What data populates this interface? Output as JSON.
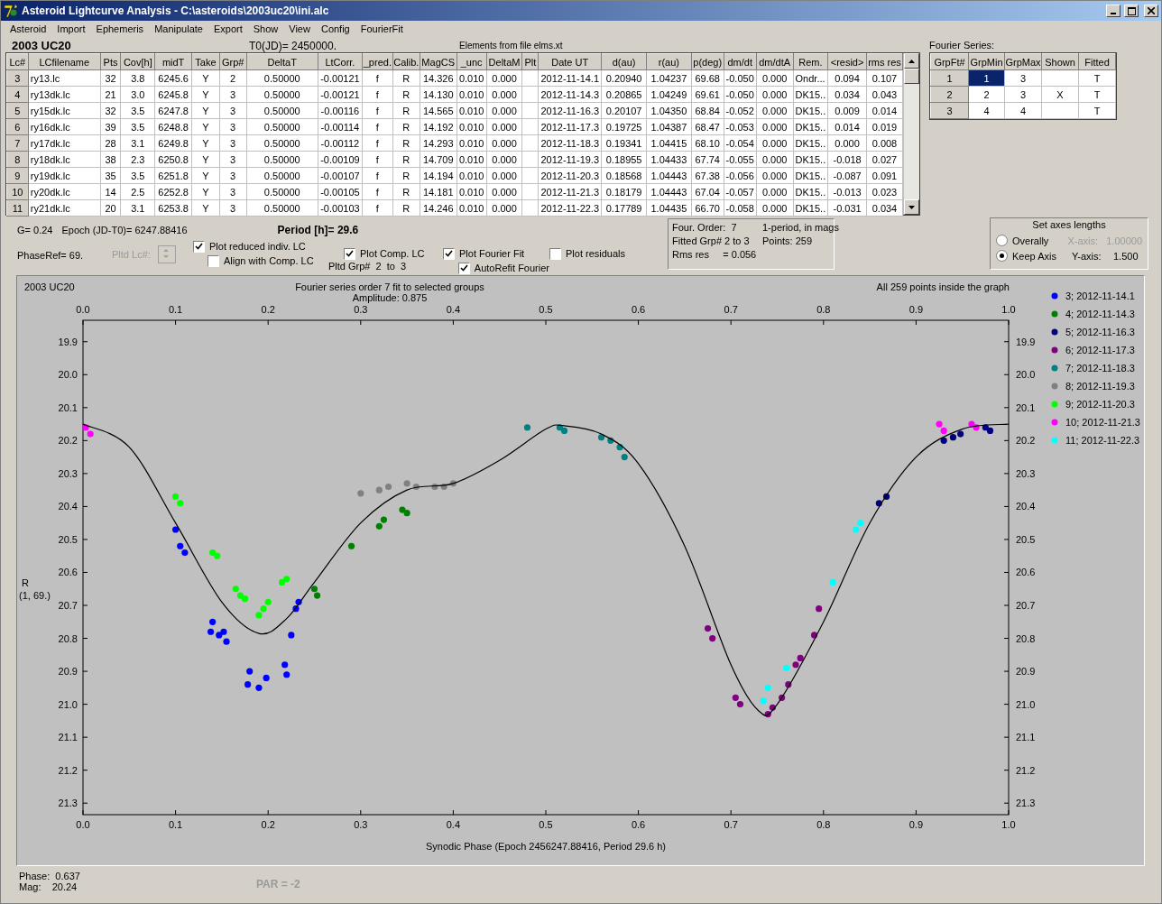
{
  "window": {
    "title": "Asteroid Lightcurve Analysis - C:\\asteroids\\2003uc20\\ini.alc"
  },
  "menu": [
    "Asteroid",
    "Import",
    "Ephemeris",
    "Manipulate",
    "Export",
    "Show",
    "View",
    "Config",
    "FourierFit"
  ],
  "header": {
    "asteroid": "2003 UC20",
    "t0": "T0(JD)= 2450000.",
    "elements": "Elements from file elms.xt"
  },
  "table": {
    "columns": [
      "Lc#",
      "LCfilename",
      "Pts",
      "Cov[h]",
      "midT",
      "Take",
      "Grp#",
      "DeltaT",
      "LtCorr.",
      "_pred.",
      "Calib.",
      "MagCS",
      "_unc",
      "DeltaM",
      "Plt",
      "Date UT",
      "d(au)",
      "r(au)",
      "p(deg)",
      "dm/dt",
      "dm/dtA",
      "Rem.",
      "<resid>",
      "rms res"
    ],
    "rows": [
      [
        "3",
        "ry13.lc",
        "32",
        "3.8",
        "6245.6",
        "Y",
        "2",
        "0.50000",
        "-0.00121",
        "f",
        "R",
        "14.326",
        "0.010",
        "0.000",
        "",
        "2012-11-14.1",
        "0.20940",
        "1.04237",
        "69.68",
        "-0.050",
        "0.000",
        "Ondr...",
        "0.094",
        "0.107"
      ],
      [
        "4",
        "ry13dk.lc",
        "21",
        "3.0",
        "6245.8",
        "Y",
        "3",
        "0.50000",
        "-0.00121",
        "f",
        "R",
        "14.130",
        "0.010",
        "0.000",
        "",
        "2012-11-14.3",
        "0.20865",
        "1.04249",
        "69.61",
        "-0.050",
        "0.000",
        "DK15..",
        "0.034",
        "0.043"
      ],
      [
        "5",
        "ry15dk.lc",
        "32",
        "3.5",
        "6247.8",
        "Y",
        "3",
        "0.50000",
        "-0.00116",
        "f",
        "R",
        "14.565",
        "0.010",
        "0.000",
        "",
        "2012-11-16.3",
        "0.20107",
        "1.04350",
        "68.84",
        "-0.052",
        "0.000",
        "DK15..",
        "0.009",
        "0.014"
      ],
      [
        "6",
        "ry16dk.lc",
        "39",
        "3.5",
        "6248.8",
        "Y",
        "3",
        "0.50000",
        "-0.00114",
        "f",
        "R",
        "14.192",
        "0.010",
        "0.000",
        "",
        "2012-11-17.3",
        "0.19725",
        "1.04387",
        "68.47",
        "-0.053",
        "0.000",
        "DK15..",
        "0.014",
        "0.019"
      ],
      [
        "7",
        "ry17dk.lc",
        "28",
        "3.1",
        "6249.8",
        "Y",
        "3",
        "0.50000",
        "-0.00112",
        "f",
        "R",
        "14.293",
        "0.010",
        "0.000",
        "",
        "2012-11-18.3",
        "0.19341",
        "1.04415",
        "68.10",
        "-0.054",
        "0.000",
        "DK15..",
        "0.000",
        "0.008"
      ],
      [
        "8",
        "ry18dk.lc",
        "38",
        "2.3",
        "6250.8",
        "Y",
        "3",
        "0.50000",
        "-0.00109",
        "f",
        "R",
        "14.709",
        "0.010",
        "0.000",
        "",
        "2012-11-19.3",
        "0.18955",
        "1.04433",
        "67.74",
        "-0.055",
        "0.000",
        "DK15..",
        "-0.018",
        "0.027"
      ],
      [
        "9",
        "ry19dk.lc",
        "35",
        "3.5",
        "6251.8",
        "Y",
        "3",
        "0.50000",
        "-0.00107",
        "f",
        "R",
        "14.194",
        "0.010",
        "0.000",
        "",
        "2012-11-20.3",
        "0.18568",
        "1.04443",
        "67.38",
        "-0.056",
        "0.000",
        "DK15..",
        "-0.087",
        "0.091"
      ],
      [
        "10",
        "ry20dk.lc",
        "14",
        "2.5",
        "6252.8",
        "Y",
        "3",
        "0.50000",
        "-0.00105",
        "f",
        "R",
        "14.181",
        "0.010",
        "0.000",
        "",
        "2012-11-21.3",
        "0.18179",
        "1.04443",
        "67.04",
        "-0.057",
        "0.000",
        "DK15..",
        "-0.013",
        "0.023"
      ],
      [
        "11",
        "ry21dk.lc",
        "20",
        "3.1",
        "6253.8",
        "Y",
        "3",
        "0.50000",
        "-0.00103",
        "f",
        "R",
        "14.246",
        "0.010",
        "0.000",
        "",
        "2012-11-22.3",
        "0.17789",
        "1.04435",
        "66.70",
        "-0.058",
        "0.000",
        "DK15..",
        "-0.031",
        "0.034"
      ]
    ]
  },
  "fourier_series": {
    "label": "Fourier Series:",
    "columns": [
      "GrpFt#",
      "GrpMin",
      "GrpMax",
      "Shown",
      "Fitted"
    ],
    "rows": [
      {
        "cells": [
          {
            "text": "1",
            "selected": false
          },
          {
            "text": "1",
            "selected": true
          },
          {
            "text": "3",
            "selected": false
          },
          {
            "text": "",
            "selected": false
          },
          {
            "text": "T",
            "selected": false
          }
        ]
      },
      {
        "cells": [
          {
            "text": "2",
            "selected": false
          },
          {
            "text": "2",
            "selected": false
          },
          {
            "text": "3",
            "selected": false
          },
          {
            "text": "X",
            "selected": false
          },
          {
            "text": "T",
            "selected": false
          }
        ]
      },
      {
        "cells": [
          {
            "text": "3",
            "selected": false
          },
          {
            "text": "4",
            "selected": false
          },
          {
            "text": "4",
            "selected": false
          },
          {
            "text": "",
            "selected": false
          },
          {
            "text": "T",
            "selected": false
          }
        ]
      }
    ]
  },
  "parameters": {
    "g": "G= 0.24",
    "epoch": "Epoch (JD-T0)= 6247.88416",
    "period": "Period [h]= 29.6",
    "phase_ref": "PhaseRef= 69.",
    "pltd_lc": {
      "label": "Pltd Lc#:",
      "disabled": true
    },
    "pltd_grp": "Pltd Grp#  2  to  3"
  },
  "options": [
    {
      "label": "Plot reduced indiv. LC",
      "checked": true
    },
    {
      "label": "Align with Comp. LC",
      "checked": false
    },
    {
      "label": "Plot Comp. LC",
      "checked": true
    },
    {
      "label": "Plot Fourier Fit",
      "checked": true
    },
    {
      "label": "AutoRefit Fourier",
      "checked": true
    },
    {
      "label": "Plot residuals",
      "checked": false
    }
  ],
  "fit_info": [
    [
      "Four. Order:  7",
      "1-period, in mags"
    ],
    [
      "Fitted Grp# 2 to 3",
      "Points: 259"
    ],
    [
      "Rms res     = 0.056"
    ]
  ],
  "axes": {
    "title": "Set axes lengths",
    "options": [
      {
        "label": "Overally",
        "selected": false,
        "axis_label": "X-axis:",
        "value": "1.00000",
        "disabled": true
      },
      {
        "label": "Keep Axis",
        "selected": true,
        "axis_label": "Y-axis:",
        "value": "1.500",
        "disabled": false
      }
    ]
  },
  "plot": {
    "title": "2003 UC20",
    "subtitle": "Fourier series order 7 fit to selected groups",
    "amplitude": "Amplitude: 0.875",
    "status": "All 259 points inside the graph",
    "ylabel_sub": "(1, 69.)",
    "top_tick_labels": [
      "0.0",
      "0.1",
      "0.2",
      "0.3",
      "0.4",
      "0.5",
      "0.6",
      "0.7",
      "0.8",
      "0.9",
      "1.0"
    ],
    "right_tick_labels": [
      "19.9",
      "20.0",
      "20.1",
      "20.2",
      "20.3",
      "20.4",
      "20.5",
      "20.6",
      "20.7",
      "20.8",
      "20.9",
      "21.0",
      "21.1",
      "21.2",
      "21.3"
    ],
    "chart_data": {
      "type": "scatter",
      "xlabel": "Synodic Phase (Epoch 2456247.88416, Period 29.6 h)",
      "ylabel": "R",
      "xlim": [
        0,
        1
      ],
      "ylim": [
        21.335,
        19.835
      ],
      "legend": "right",
      "xticks": [
        {
          "value": 0,
          "label": "0.0"
        },
        0.1,
        0.2,
        0.3,
        0.4,
        0.5,
        0.6,
        0.7,
        0.8,
        0.9,
        {
          "value": 1,
          "label": "1.0"
        }
      ],
      "yticks": [
        19.9,
        {
          "value": 20,
          "label": "20.0"
        },
        20.1,
        20.2,
        20.3,
        20.4,
        20.5,
        20.6,
        20.7,
        20.8,
        20.9,
        {
          "value": 21,
          "label": "21.0"
        },
        21.1,
        21.2,
        21.3
      ],
      "series": [
        {
          "name": "3; 2012-11-14.1",
          "color": "#0000ff",
          "x": [
            0.1,
            0.105,
            0.11,
            0.14,
            0.138,
            0.147,
            0.155,
            0.152,
            0.18,
            0.178,
            0.19,
            0.198,
            0.218,
            0.22,
            0.225,
            0.23,
            0.233
          ],
          "values": [
            20.47,
            20.52,
            20.54,
            20.75,
            20.78,
            20.79,
            20.81,
            20.78,
            20.9,
            20.94,
            20.95,
            20.92,
            20.88,
            20.91,
            20.79,
            20.71,
            20.69
          ]
        },
        {
          "name": "4; 2012-11-14.3",
          "color": "#008000",
          "x": [
            0.25,
            0.253,
            0.29,
            0.32,
            0.325,
            0.345,
            0.35
          ],
          "values": [
            20.65,
            20.67,
            20.52,
            20.46,
            20.44,
            20.41,
            20.42
          ]
        },
        {
          "name": "5; 2012-11-16.3",
          "color": "#000080",
          "x": [
            0.86,
            0.868,
            0.93,
            0.94,
            0.948,
            0.975,
            0.98
          ],
          "values": [
            20.39,
            20.37,
            20.2,
            20.19,
            20.18,
            20.16,
            20.17
          ]
        },
        {
          "name": "6; 2012-11-17.3",
          "color": "#800080",
          "x": [
            0.675,
            0.68,
            0.705,
            0.71,
            0.74,
            0.745,
            0.755,
            0.762,
            0.77,
            0.775,
            0.79,
            0.795
          ],
          "values": [
            20.77,
            20.8,
            20.98,
            21.0,
            21.03,
            21.01,
            20.98,
            20.94,
            20.88,
            20.86,
            20.79,
            20.71
          ]
        },
        {
          "name": "7; 2012-11-18.3",
          "color": "#008080",
          "x": [
            0.48,
            0.515,
            0.52,
            0.56,
            0.57,
            0.58,
            0.585
          ],
          "values": [
            20.16,
            20.16,
            20.17,
            20.19,
            20.2,
            20.22,
            20.25
          ]
        },
        {
          "name": "8; 2012-11-19.3",
          "color": "#808080",
          "x": [
            0.3,
            0.32,
            0.33,
            0.35,
            0.36,
            0.38,
            0.39,
            0.4
          ],
          "values": [
            20.36,
            20.35,
            20.34,
            20.33,
            20.34,
            20.34,
            20.34,
            20.33
          ]
        },
        {
          "name": "9; 2012-11-20.3",
          "color": "#00ff00",
          "x": [
            0.1,
            0.105,
            0.14,
            0.145,
            0.165,
            0.17,
            0.175,
            0.19,
            0.195,
            0.2,
            0.215,
            0.22
          ],
          "values": [
            20.37,
            20.39,
            20.54,
            20.55,
            20.65,
            20.67,
            20.68,
            20.73,
            20.71,
            20.69,
            20.63,
            20.62
          ]
        },
        {
          "name": "10; 2012-11-21.3",
          "color": "#ff00ff",
          "x": [
            0.003,
            0.008,
            0.925,
            0.93,
            0.96,
            0.965
          ],
          "values": [
            20.16,
            20.18,
            20.15,
            20.17,
            20.15,
            20.16
          ]
        },
        {
          "name": "11; 2012-11-22.3",
          "color": "#00ffff",
          "x": [
            0.735,
            0.74,
            0.76,
            0.81,
            0.835,
            0.84
          ],
          "values": [
            20.99,
            20.95,
            20.89,
            20.63,
            20.47,
            20.45
          ]
        },
        {
          "type": "line",
          "color": "#000000",
          "x": [
            0,
            0.05,
            0.1,
            0.15,
            0.19,
            0.22,
            0.25,
            0.3,
            0.35,
            0.4,
            0.45,
            0.5,
            0.52,
            0.56,
            0.6,
            0.65,
            0.7,
            0.73,
            0.75,
            0.8,
            0.85,
            0.9,
            0.95,
            1
          ],
          "values": [
            20.15,
            20.22,
            20.45,
            20.69,
            20.785,
            20.74,
            20.63,
            20.45,
            20.35,
            20.33,
            20.26,
            20.165,
            20.155,
            20.18,
            20.27,
            20.52,
            20.88,
            21.02,
            21.0,
            20.75,
            20.45,
            20.25,
            20.165,
            20.15
          ]
        }
      ]
    }
  },
  "footer": {
    "phase": "Phase:  0.637",
    "mag": "Mag:    20.24",
    "par": "PAR = -2"
  }
}
